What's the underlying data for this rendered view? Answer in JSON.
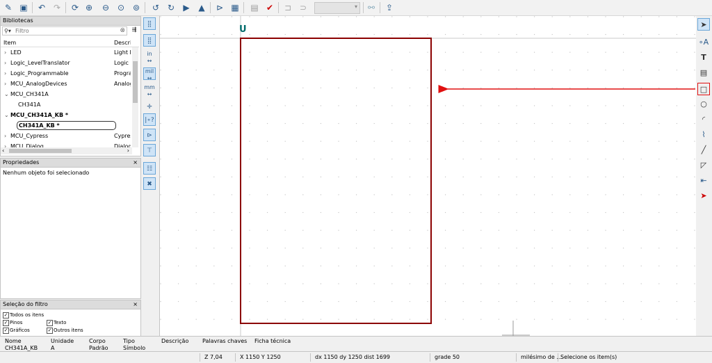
{
  "libraries": {
    "title": "Bibliotecas",
    "filter_placeholder": "Filtro",
    "col_item": "Item",
    "col_desc": "Descriç",
    "rows": [
      {
        "name": "LED",
        "desc": "Light E",
        "arrow": "›"
      },
      {
        "name": "Logic_LevelTranslator",
        "desc": "Logic le",
        "arrow": "›"
      },
      {
        "name": "Logic_Programmable",
        "desc": "Progra",
        "arrow": "›"
      },
      {
        "name": "MCU_AnalogDevices",
        "desc": "Analog",
        "arrow": "›"
      },
      {
        "name": "MCU_CH341A",
        "desc": "",
        "arrow": "⌄"
      },
      {
        "name": "CH341A",
        "desc": "",
        "arrow": ""
      },
      {
        "name": "MCU_CH341A_KB *",
        "desc": "",
        "arrow": "⌄"
      },
      {
        "name": "CH341A_KB *",
        "desc": "",
        "arrow": ""
      },
      {
        "name": "MCU_Cypress",
        "desc": "Cypres",
        "arrow": "›"
      },
      {
        "name": "MCU_Dialog",
        "desc": "Dialog",
        "arrow": "›"
      }
    ]
  },
  "properties": {
    "title": "Propriedades",
    "empty_text": "Nenhum objeto foi selecionado"
  },
  "filter_selection": {
    "title": "Seleção do filtro",
    "all_items": "Todos os itens",
    "pins": "Pinos",
    "text": "Texto",
    "graphics": "Gráficos",
    "other_items": "Outros itens"
  },
  "left_toolbar": {
    "in": "in",
    "mil": "mil",
    "mm": "mm"
  },
  "canvas": {
    "ref_label": "U"
  },
  "info_bar": {
    "name_label": "Nome",
    "name_value": "CH341A_KB",
    "unit_label": "Unidade",
    "unit_value": "A",
    "body_label": "Corpo",
    "body_value": "Padrão",
    "type_label": "Tipo",
    "type_value": "Símbolo",
    "desc_label": "Descrição",
    "keywords_label": "Palavras chaves",
    "datasheet_label": "Ficha técnica"
  },
  "status_bar": {
    "zoom": "Z 7,04",
    "xy": "X 1150  Y 1250",
    "delta": "dx 1150  dy 1250  dist 1699",
    "grid": "grade 50",
    "units": "milésimo de ...",
    "hint": "Selecione os item(s)"
  },
  "colors": {
    "accent": "#2a5a8a",
    "body_outline": "#8b0000",
    "annotation": "#e01010",
    "ref_text": "#006b6b"
  }
}
